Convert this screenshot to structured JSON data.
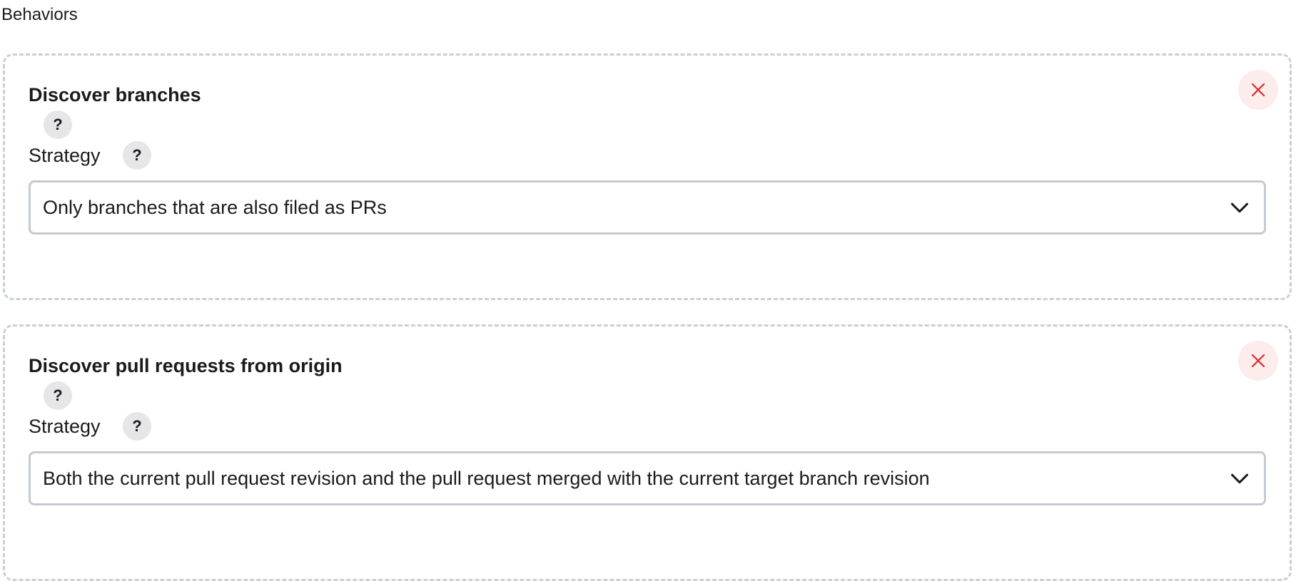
{
  "section": {
    "title": "Behaviors"
  },
  "behaviors": [
    {
      "title": "Discover branches",
      "help_label": "?",
      "strategy_label": "Strategy",
      "strategy_help_label": "?",
      "strategy_value": "Only branches that are also filed as PRs",
      "remove_icon": "close-icon",
      "remove_color": "#d92d2d"
    },
    {
      "title": "Discover pull requests from origin",
      "help_label": "?",
      "strategy_label": "Strategy",
      "strategy_help_label": "?",
      "strategy_value": "Both the current pull request revision and the pull request merged with the current target branch revision",
      "remove_icon": "close-icon",
      "remove_color": "#d92d2d"
    }
  ]
}
